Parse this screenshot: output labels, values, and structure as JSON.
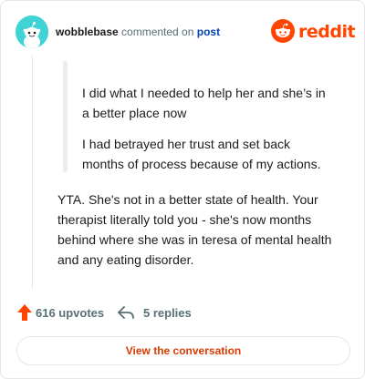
{
  "header": {
    "username": "wobblebase",
    "action": "commented on",
    "target": "post",
    "brand": "reddit"
  },
  "quote": {
    "paragraphs": [
      "I did what I needed to help her and she’s in a better place now",
      "I had betrayed her trust and set back months of process because of my actions."
    ]
  },
  "reply": {
    "text": "YTA. She's not in a better state of health. Your therapist literally told you - she's now months behind where she was in teresa of mental health and any eating disorder."
  },
  "footer": {
    "upvotes": "616 upvotes",
    "replies": "5 replies",
    "view_button": "View the conversation"
  },
  "colors": {
    "brand": "#ff4500",
    "avatar": "#3fd3d6",
    "link": "#0045ac",
    "cta": "#d93a00"
  },
  "icons": {
    "avatar": "snoo-avatar-icon",
    "logo": "reddit-logo-icon",
    "upvote": "upvote-arrow-icon",
    "reply": "reply-arrow-icon"
  }
}
